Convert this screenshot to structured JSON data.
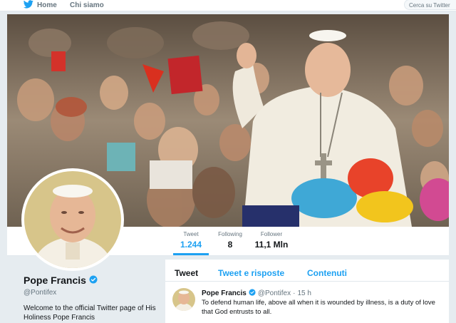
{
  "nav": {
    "home_label": "Home",
    "about_label": "Chi siamo",
    "search_placeholder": "Cerca su Twitter"
  },
  "stats": [
    {
      "label": "Tweet",
      "value": "1.244"
    },
    {
      "label": "Following",
      "value": "8"
    },
    {
      "label": "Follower",
      "value": "11,1 Mln"
    }
  ],
  "profile": {
    "name": "Pope Francis",
    "handle": "@Pontifex",
    "bio": "Welcome to the official Twitter page of His Holiness Pope Francis"
  },
  "tabs": [
    {
      "label": "Tweet"
    },
    {
      "label": "Tweet e risposte"
    },
    {
      "label": "Contenuti"
    }
  ],
  "tweet": {
    "author": "Pope Francis",
    "handle": "@Pontifex",
    "separator": "·",
    "time": "15 h",
    "text": "To defend human life, above all when it is wounded by illness, is a duty of love that God entrusts to all."
  },
  "colors": {
    "accent": "#1da1f2",
    "background": "#e6ecf0",
    "muted_text": "#66757f"
  },
  "icons": [
    "twitter-bird-icon",
    "verified-badge-icon"
  ]
}
